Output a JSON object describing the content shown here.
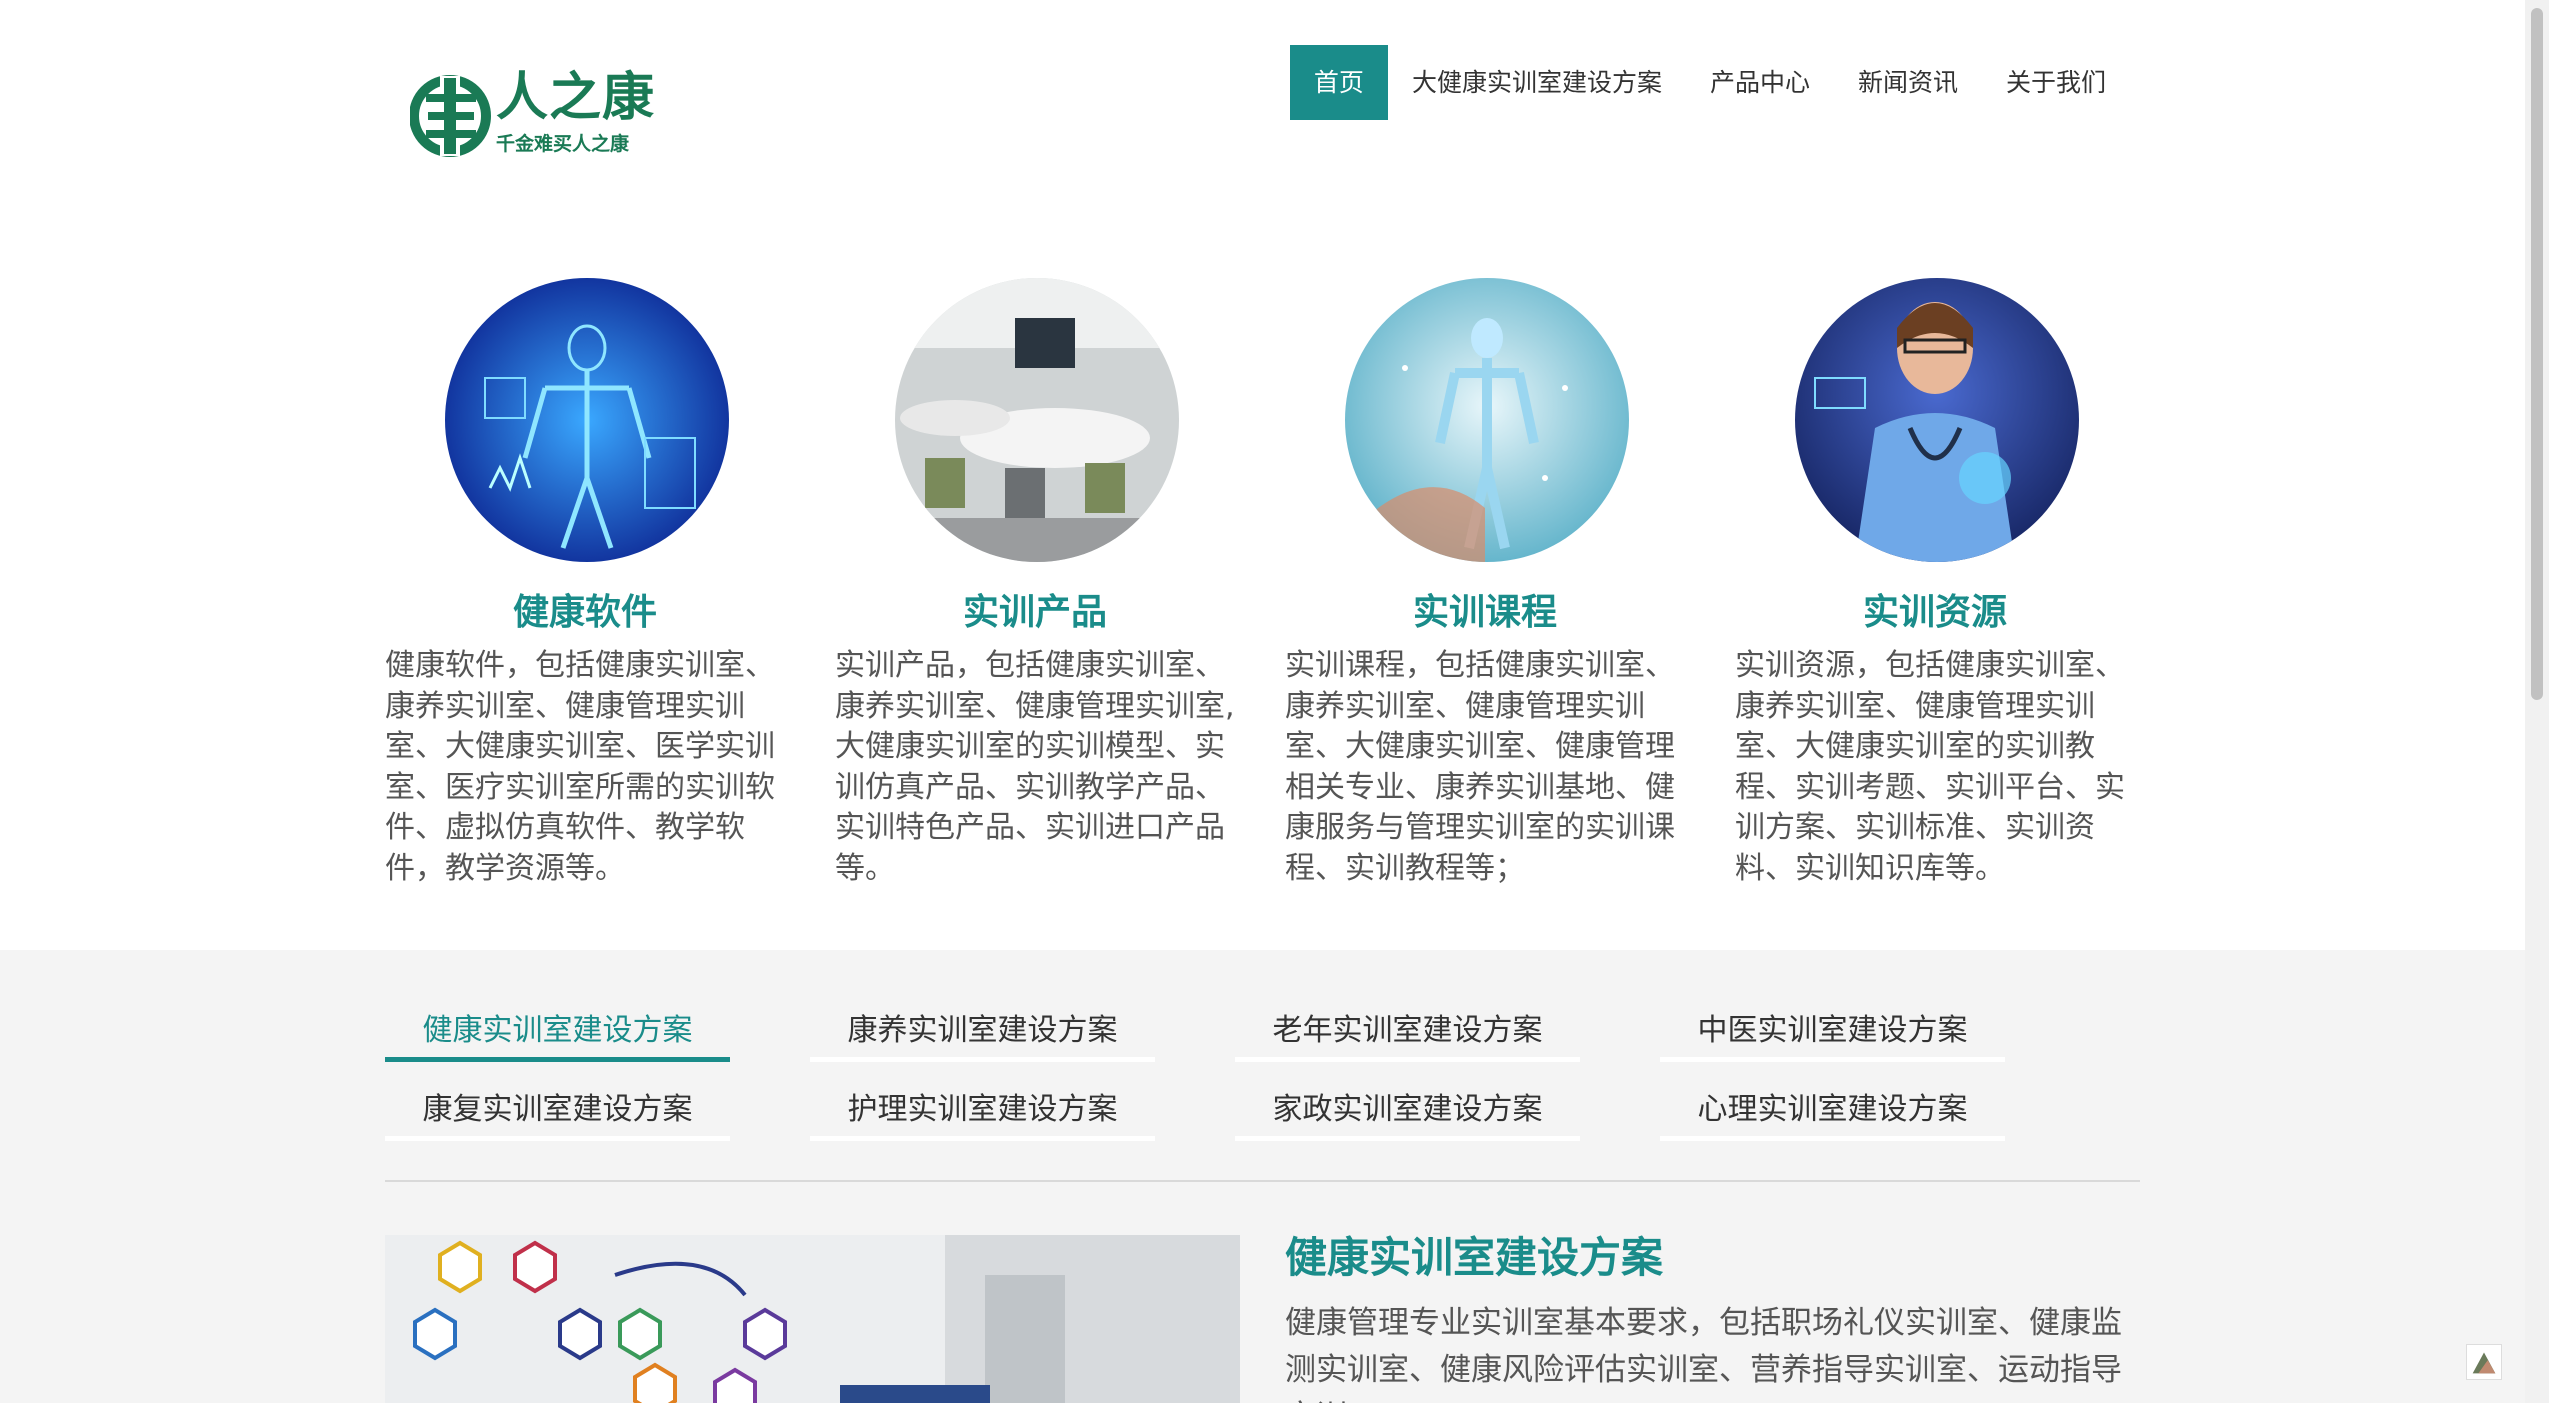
{
  "header": {
    "logo_title": "人之康",
    "logo_subtitle": "千金难买人之康",
    "nav": [
      {
        "label": "首页",
        "active": true
      },
      {
        "label": "大健康实训室建设方案",
        "active": false
      },
      {
        "label": "产品中心",
        "active": false
      },
      {
        "label": "新闻资讯",
        "active": false
      },
      {
        "label": "关于我们",
        "active": false
      }
    ]
  },
  "features": [
    {
      "title": "健康软件",
      "desc": "健康软件，包括健康实训室、康养实训室、健康管理实训室、大健康实训室、医学实训室、医疗实训室所需的实训软件、虚拟仿真软件、教学软件，教学资源等。"
    },
    {
      "title": "实训产品",
      "desc": "实训产品，包括健康实训室、康养实训室、健康管理实训室,大健康实训室的实训模型、实训仿真产品、实训教学产品、实训特色产品、实训进口产品等。"
    },
    {
      "title": "实训课程",
      "desc": "实训课程，包括健康实训室、康养实训室、健康管理实训室、大健康实训室、健康管理相关专业、康养实训基地、健康服务与管理实训室的实训课程、实训教程等；"
    },
    {
      "title": "实训资源",
      "desc": "实训资源，包括健康实训室、康养实训室、健康管理实训室、大健康实训室的实训教程、实训考题、实训平台、实训方案、实训标准、实训资料、实训知识库等。"
    }
  ],
  "tabs": [
    {
      "label": "健康实训室建设方案",
      "active": true
    },
    {
      "label": "康养实训室建设方案",
      "active": false
    },
    {
      "label": "老年实训室建设方案",
      "active": false
    },
    {
      "label": "中医实训室建设方案",
      "active": false
    },
    {
      "label": "康复实训室建设方案",
      "active": false
    },
    {
      "label": "护理实训室建设方案",
      "active": false
    },
    {
      "label": "家政实训室建设方案",
      "active": false
    },
    {
      "label": "心理实训室建设方案",
      "active": false
    }
  ],
  "case": {
    "title": "健康实训室建设方案",
    "desc": "健康管理专业实训室基本要求，包括职场礼仪实训室、健康监测实训室、健康风险评估实训室、营养指导实训室、运动指导实训"
  },
  "colors": {
    "accent": "#1a8c8a",
    "logo_green": "#1a7a55"
  }
}
